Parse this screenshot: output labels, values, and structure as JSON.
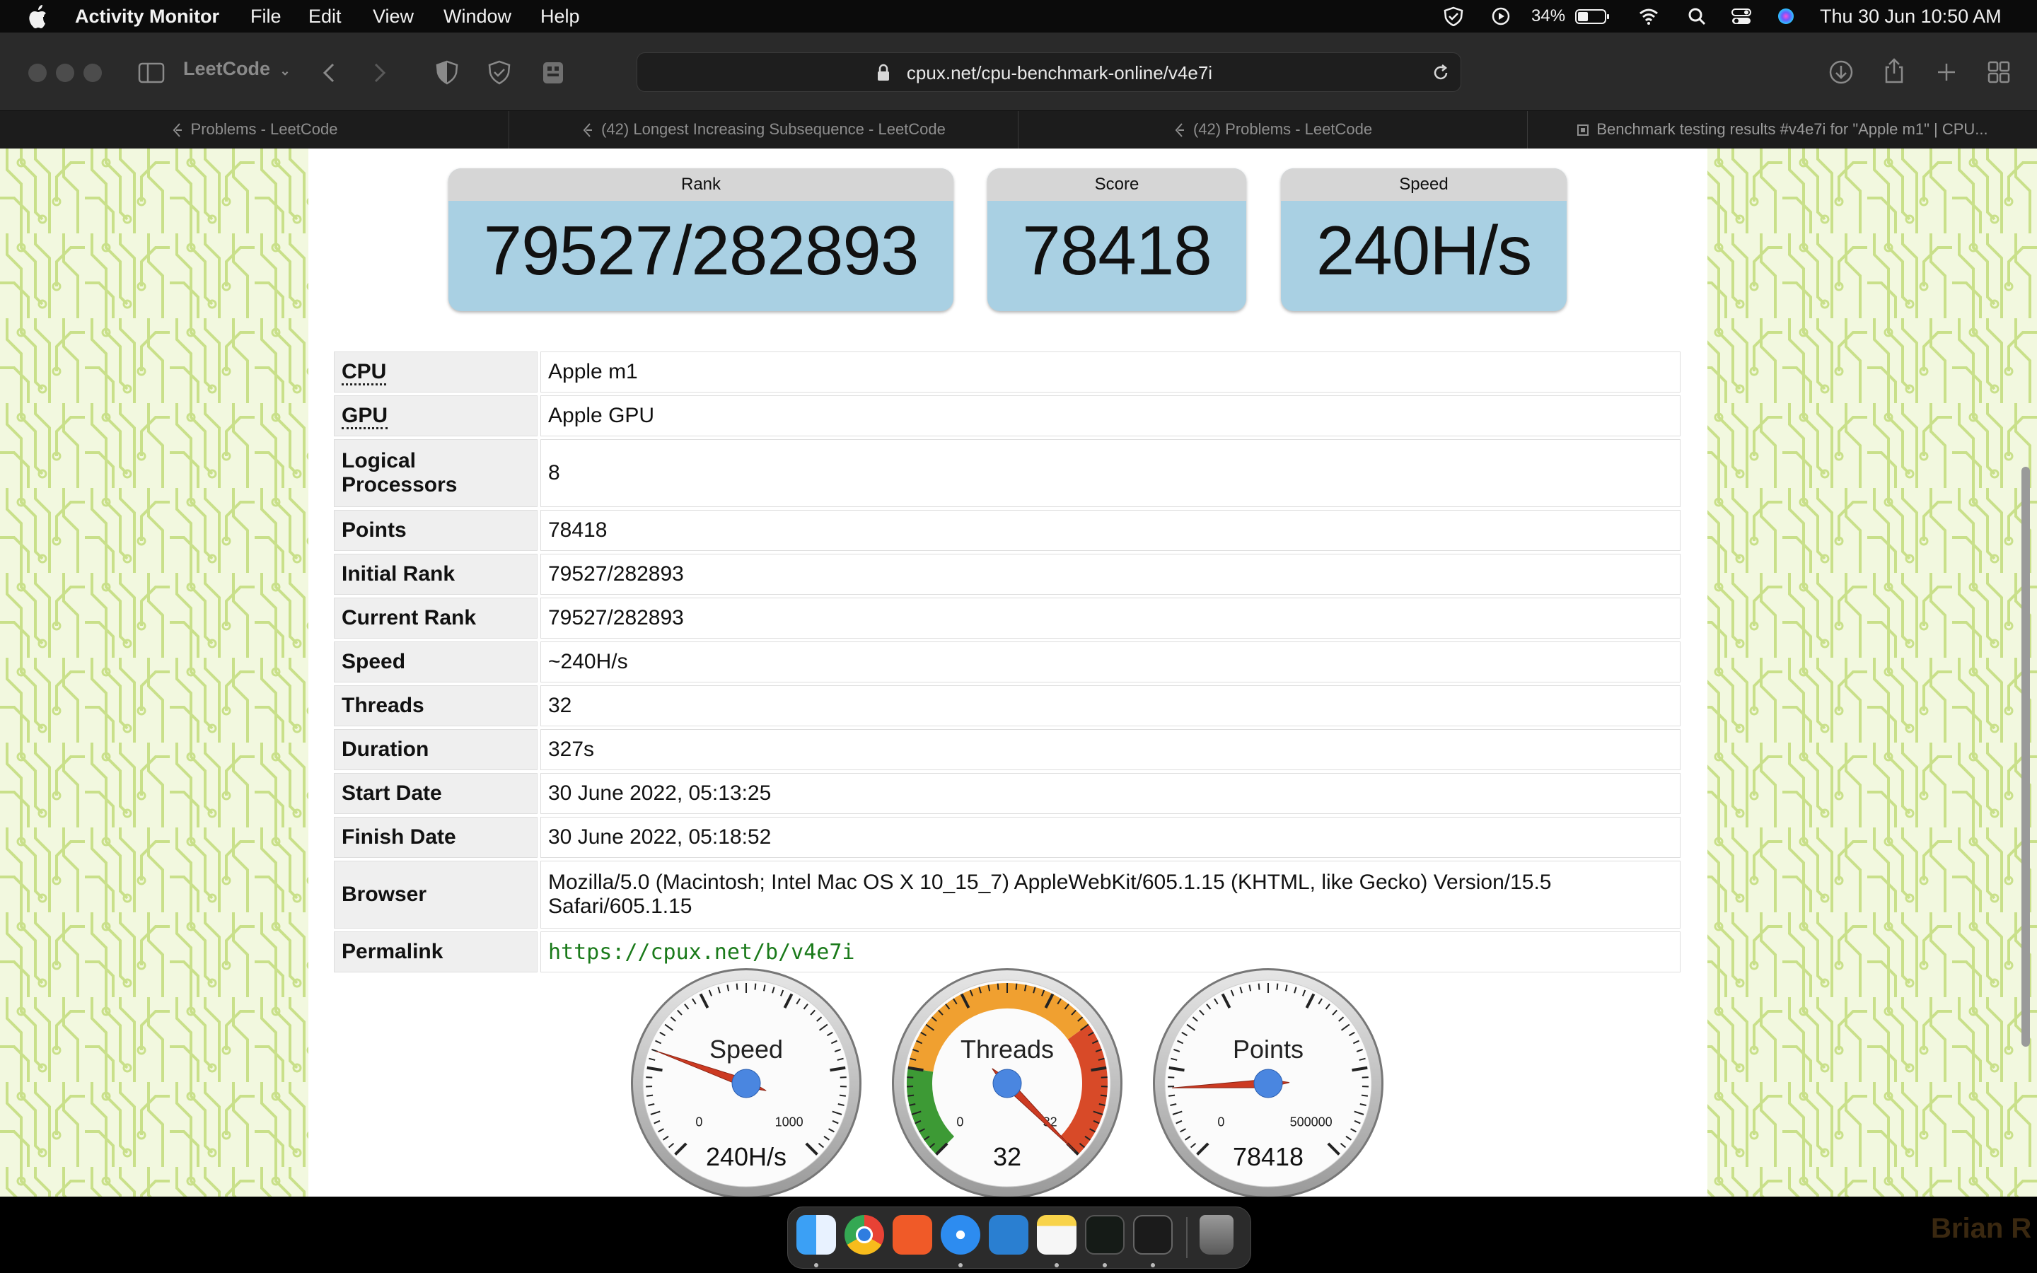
{
  "menubar": {
    "app_name": "Activity Monitor",
    "menus": [
      "File",
      "Edit",
      "View",
      "Window",
      "Help"
    ],
    "battery_percent": "34%",
    "clock": "Thu 30 Jun  10:50 AM"
  },
  "browser": {
    "tab_group": "LeetCode",
    "url": "cpux.net/cpu-benchmark-online/v4e7i",
    "tabs": [
      {
        "label": "Problems - LeetCode"
      },
      {
        "label": "(42) Longest Increasing Subsequence - LeetCode"
      },
      {
        "label": "(42) Problems - LeetCode"
      },
      {
        "label": "Benchmark testing results #v4e7i for \"Apple m1\" | CPU..."
      }
    ]
  },
  "stats": {
    "rank": {
      "label": "Rank",
      "value": "79527/282893"
    },
    "score": {
      "label": "Score",
      "value": "78418"
    },
    "speed": {
      "label": "Speed",
      "value": "240H/s"
    }
  },
  "details": [
    {
      "key": "CPU",
      "value": "Apple m1"
    },
    {
      "key": "GPU",
      "value": "Apple GPU"
    },
    {
      "key": "Logical Processors",
      "value": "8"
    },
    {
      "key": "Points",
      "value": "78418"
    },
    {
      "key": "Initial Rank",
      "value": "79527/282893"
    },
    {
      "key": "Current Rank",
      "value": "79527/282893"
    },
    {
      "key": "Speed",
      "value": "~240H/s"
    },
    {
      "key": "Threads",
      "value": "32"
    },
    {
      "key": "Duration",
      "value": "327s"
    },
    {
      "key": "Start Date",
      "value": "30 June 2022, 05:13:25"
    },
    {
      "key": "Finish Date",
      "value": "30 June 2022, 05:18:52"
    },
    {
      "key": "Browser",
      "value": "Mozilla/5.0 (Macintosh; Intel Mac OS X 10_15_7) AppleWebKit/605.1.15 (KHTML, like Gecko) Version/15.5 Safari/605.1.15"
    },
    {
      "key": "Permalink",
      "value": "https://cpux.net/b/v4e7i"
    }
  ],
  "gauges": [
    {
      "title": "Speed",
      "min_label": "0",
      "max_label": "1000",
      "readout": "240H/s",
      "value": 240,
      "min": 0,
      "max": 1000,
      "zones": false
    },
    {
      "title": "Threads",
      "min_label": "0",
      "max_label": "32",
      "readout": "32",
      "value": 32,
      "min": 0,
      "max": 32,
      "zones": true
    },
    {
      "title": "Points",
      "min_label": "0",
      "max_label": "500000",
      "readout": "78418",
      "value": 78418,
      "min": 0,
      "max": 500000,
      "zones": false
    }
  ],
  "colors": {
    "stat_box": "#a9d0e3",
    "page_pattern_bg": "#f2f8df",
    "page_pattern_lines": "#c9e08a",
    "permalink": "#1a7a1a",
    "needle": "#cc3a22",
    "gauge_hub": "#4a86e0",
    "zone_green": "#3d9a35",
    "zone_orange": "#f0a030",
    "zone_red": "#d84a28"
  },
  "icons": [
    "apple-icon",
    "shield-check-icon",
    "play-circle-icon",
    "battery-icon",
    "wifi-icon",
    "search-icon",
    "control-center-icon",
    "siri-icon",
    "sidebar-icon",
    "back-icon",
    "forward-icon",
    "privacy-shield-icon",
    "download-icon",
    "share-icon",
    "new-tab-icon",
    "tab-overview-icon",
    "lock-icon",
    "reload-icon"
  ],
  "dock": {
    "apps": [
      "Finder",
      "Chrome",
      "Brave",
      "Safari",
      "VS Code",
      "Notes",
      "Activity Monitor",
      "Terminal",
      "Trash"
    ]
  },
  "watermark": "Brian R"
}
